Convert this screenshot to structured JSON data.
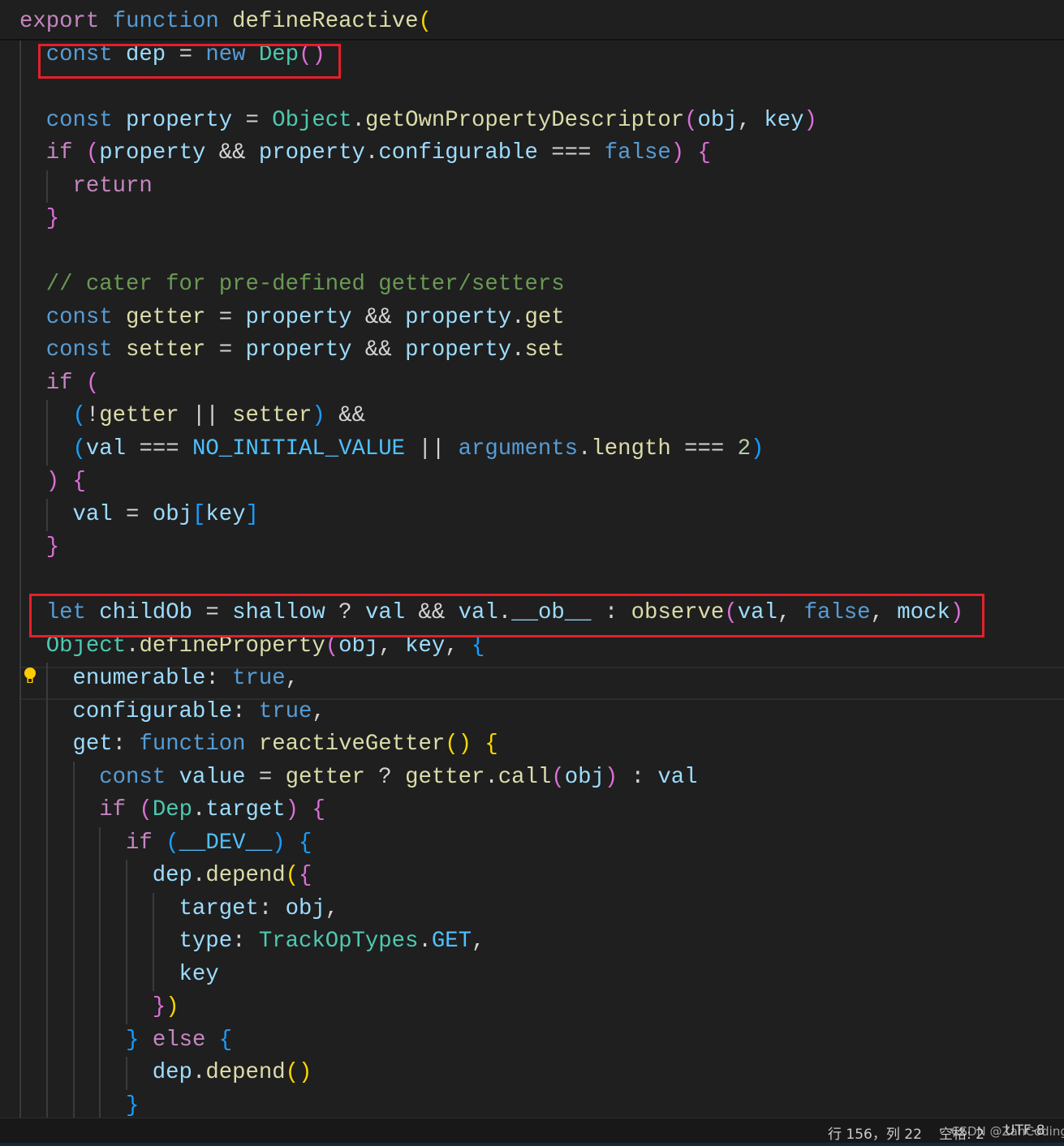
{
  "editor": {
    "indent_chars": 2,
    "current_line_index": 20,
    "highlighted_lines": [
      1,
      18
    ],
    "colors": {
      "background": "#1f1f1f",
      "keyword": "#569cd6",
      "control": "#c586c0",
      "variable": "#9cdcfe",
      "function": "#dcdcaa",
      "class": "#4ec9b0",
      "comment": "#6a9955",
      "bracket_level1": "#ffd700",
      "bracket_level2": "#da70d6",
      "bracket_level3": "#179fff",
      "highlight_box": "#e5202a"
    },
    "lines": [
      {
        "indent": 0,
        "tokens": [
          [
            "export",
            "ctl"
          ],
          [
            " "
          ],
          [
            "function",
            "kw"
          ],
          [
            " "
          ],
          [
            "defineReactive",
            "fn"
          ],
          [
            "(",
            "b1"
          ]
        ]
      },
      {
        "indent": 1,
        "tokens": [
          [
            "const",
            "kw"
          ],
          [
            " "
          ],
          [
            "dep",
            "var"
          ],
          [
            " = ",
            "op"
          ],
          [
            "new",
            "kw"
          ],
          [
            " "
          ],
          [
            "Dep",
            "cls"
          ],
          [
            "()",
            "b2"
          ]
        ]
      },
      {
        "indent": 1,
        "tokens": []
      },
      {
        "indent": 1,
        "tokens": [
          [
            "const",
            "kw"
          ],
          [
            " "
          ],
          [
            "property",
            "var"
          ],
          [
            " = ",
            "op"
          ],
          [
            "Object",
            "cls"
          ],
          [
            ".",
            "op"
          ],
          [
            "getOwnPropertyDescriptor",
            "fn"
          ],
          [
            "(",
            "b2"
          ],
          [
            "obj",
            "var"
          ],
          [
            ", ",
            "op"
          ],
          [
            "key",
            "var"
          ],
          [
            ")",
            "b2"
          ]
        ]
      },
      {
        "indent": 1,
        "tokens": [
          [
            "if",
            "ctl"
          ],
          [
            " "
          ],
          [
            "(",
            "b2"
          ],
          [
            "property",
            "var"
          ],
          [
            " && ",
            "op"
          ],
          [
            "property",
            "var"
          ],
          [
            ".",
            "op"
          ],
          [
            "configurable",
            "var"
          ],
          [
            " === ",
            "op"
          ],
          [
            "false",
            "kw"
          ],
          [
            ")",
            "b2"
          ],
          [
            " "
          ],
          [
            "{",
            "b2"
          ]
        ]
      },
      {
        "indent": 2,
        "tokens": [
          [
            "return",
            "ctl"
          ]
        ]
      },
      {
        "indent": 1,
        "tokens": [
          [
            "}",
            "b2"
          ]
        ]
      },
      {
        "indent": 1,
        "tokens": []
      },
      {
        "indent": 1,
        "tokens": [
          [
            "// cater for pre-defined getter/setters",
            "cmt"
          ]
        ]
      },
      {
        "indent": 1,
        "tokens": [
          [
            "const",
            "kw"
          ],
          [
            " "
          ],
          [
            "getter",
            "fn"
          ],
          [
            " = ",
            "op"
          ],
          [
            "property",
            "var"
          ],
          [
            " && ",
            "op"
          ],
          [
            "property",
            "var"
          ],
          [
            ".",
            "op"
          ],
          [
            "get",
            "fn"
          ]
        ]
      },
      {
        "indent": 1,
        "tokens": [
          [
            "const",
            "kw"
          ],
          [
            " "
          ],
          [
            "setter",
            "fn"
          ],
          [
            " = ",
            "op"
          ],
          [
            "property",
            "var"
          ],
          [
            " && ",
            "op"
          ],
          [
            "property",
            "var"
          ],
          [
            ".",
            "op"
          ],
          [
            "set",
            "fn"
          ]
        ]
      },
      {
        "indent": 1,
        "tokens": [
          [
            "if",
            "ctl"
          ],
          [
            " "
          ],
          [
            "(",
            "b2"
          ]
        ]
      },
      {
        "indent": 2,
        "tokens": [
          [
            "(",
            "b3"
          ],
          [
            "!",
            "op"
          ],
          [
            "getter",
            "fn"
          ],
          [
            " || ",
            "op"
          ],
          [
            "setter",
            "fn"
          ],
          [
            ")",
            "b3"
          ],
          [
            " &&",
            "op"
          ]
        ]
      },
      {
        "indent": 2,
        "tokens": [
          [
            "(",
            "b3"
          ],
          [
            "val",
            "var"
          ],
          [
            " === ",
            "op"
          ],
          [
            "NO_INITIAL_VALUE",
            "cst"
          ],
          [
            " || ",
            "op"
          ],
          [
            "arguments",
            "kw"
          ],
          [
            ".",
            "op"
          ],
          [
            "length",
            "fn"
          ],
          [
            " === ",
            "op"
          ],
          [
            "2",
            "num"
          ],
          [
            ")",
            "b3"
          ]
        ]
      },
      {
        "indent": 1,
        "tokens": [
          [
            ")",
            "b2"
          ],
          [
            " "
          ],
          [
            "{",
            "b2"
          ]
        ]
      },
      {
        "indent": 2,
        "tokens": [
          [
            "val",
            "var"
          ],
          [
            " = ",
            "op"
          ],
          [
            "obj",
            "var"
          ],
          [
            "[",
            "b3"
          ],
          [
            "key",
            "var"
          ],
          [
            "]",
            "b3"
          ]
        ]
      },
      {
        "indent": 1,
        "tokens": [
          [
            "}",
            "b2"
          ]
        ]
      },
      {
        "indent": 1,
        "tokens": []
      },
      {
        "indent": 1,
        "tokens": [
          [
            "let",
            "kw"
          ],
          [
            " "
          ],
          [
            "childOb",
            "var"
          ],
          [
            " = ",
            "op"
          ],
          [
            "shallow",
            "var"
          ],
          [
            " ? ",
            "op"
          ],
          [
            "val",
            "var"
          ],
          [
            " && ",
            "op"
          ],
          [
            "val",
            "var"
          ],
          [
            ".",
            "op"
          ],
          [
            "__ob__",
            "var"
          ],
          [
            " : ",
            "op"
          ],
          [
            "observe",
            "fn"
          ],
          [
            "(",
            "b2"
          ],
          [
            "val",
            "var"
          ],
          [
            ", ",
            "op"
          ],
          [
            "false",
            "kw"
          ],
          [
            ", ",
            "op"
          ],
          [
            "mock",
            "var"
          ],
          [
            ")",
            "b2"
          ]
        ]
      },
      {
        "indent": 1,
        "tokens": [
          [
            "Object",
            "cls"
          ],
          [
            ".",
            "op"
          ],
          [
            "defineProperty",
            "fn"
          ],
          [
            "(",
            "b2"
          ],
          [
            "obj",
            "var"
          ],
          [
            ", ",
            "op"
          ],
          [
            "key",
            "var"
          ],
          [
            ", ",
            "op"
          ],
          [
            "{",
            "b3"
          ]
        ]
      },
      {
        "indent": 2,
        "tokens": [
          [
            "enumerable",
            "var"
          ],
          [
            ": ",
            "op"
          ],
          [
            "true",
            "kw"
          ],
          [
            ",",
            "op"
          ]
        ]
      },
      {
        "indent": 2,
        "tokens": [
          [
            "configurable",
            "var"
          ],
          [
            ": ",
            "op"
          ],
          [
            "true",
            "kw"
          ],
          [
            ",",
            "op"
          ]
        ]
      },
      {
        "indent": 2,
        "tokens": [
          [
            "get",
            "var"
          ],
          [
            ": ",
            "op"
          ],
          [
            "function",
            "kw"
          ],
          [
            " "
          ],
          [
            "reactiveGetter",
            "fn"
          ],
          [
            "()",
            "b1"
          ],
          [
            " "
          ],
          [
            "{",
            "b1"
          ]
        ]
      },
      {
        "indent": 3,
        "tokens": [
          [
            "const",
            "kw"
          ],
          [
            " "
          ],
          [
            "value",
            "var"
          ],
          [
            " = ",
            "op"
          ],
          [
            "getter",
            "fn"
          ],
          [
            " ? ",
            "op"
          ],
          [
            "getter",
            "fn"
          ],
          [
            ".",
            "op"
          ],
          [
            "call",
            "fn"
          ],
          [
            "(",
            "b2"
          ],
          [
            "obj",
            "var"
          ],
          [
            ")",
            "b2"
          ],
          [
            " : ",
            "op"
          ],
          [
            "val",
            "var"
          ]
        ]
      },
      {
        "indent": 3,
        "tokens": [
          [
            "if",
            "ctl"
          ],
          [
            " "
          ],
          [
            "(",
            "b2"
          ],
          [
            "Dep",
            "cls"
          ],
          [
            ".",
            "op"
          ],
          [
            "target",
            "var"
          ],
          [
            ")",
            "b2"
          ],
          [
            " "
          ],
          [
            "{",
            "b2"
          ]
        ]
      },
      {
        "indent": 4,
        "tokens": [
          [
            "if",
            "ctl"
          ],
          [
            " "
          ],
          [
            "(",
            "b3"
          ],
          [
            "__DEV__",
            "cst"
          ],
          [
            ")",
            "b3"
          ],
          [
            " "
          ],
          [
            "{",
            "b3"
          ]
        ]
      },
      {
        "indent": 5,
        "tokens": [
          [
            "dep",
            "var"
          ],
          [
            ".",
            "op"
          ],
          [
            "depend",
            "fn"
          ],
          [
            "(",
            "b1"
          ],
          [
            "{",
            "b2"
          ]
        ]
      },
      {
        "indent": 6,
        "tokens": [
          [
            "target",
            "var"
          ],
          [
            ": ",
            "op"
          ],
          [
            "obj",
            "var"
          ],
          [
            ",",
            "op"
          ]
        ]
      },
      {
        "indent": 6,
        "tokens": [
          [
            "type",
            "var"
          ],
          [
            ": ",
            "op"
          ],
          [
            "TrackOpTypes",
            "cls"
          ],
          [
            ".",
            "op"
          ],
          [
            "GET",
            "cst"
          ],
          [
            ",",
            "op"
          ]
        ]
      },
      {
        "indent": 6,
        "tokens": [
          [
            "key",
            "var"
          ]
        ]
      },
      {
        "indent": 5,
        "tokens": [
          [
            "}",
            "b2"
          ],
          [
            ")",
            "b1"
          ]
        ]
      },
      {
        "indent": 4,
        "tokens": [
          [
            "}",
            "b3"
          ],
          [
            " "
          ],
          [
            "else",
            "ctl"
          ],
          [
            " "
          ],
          [
            "{",
            "b3"
          ]
        ]
      },
      {
        "indent": 5,
        "tokens": [
          [
            "dep",
            "var"
          ],
          [
            ".",
            "op"
          ],
          [
            "depend",
            "fn"
          ],
          [
            "()",
            "b1"
          ]
        ]
      },
      {
        "indent": 4,
        "tokens": [
          [
            "}",
            "b3"
          ]
        ]
      }
    ]
  },
  "statusbar": {
    "cursor_position": "行 156，列 22",
    "indentation": "空格: 2",
    "encoding": "UTF-8",
    "watermark": "CSDN @ZahCoding"
  },
  "icons": {
    "lightbulb": "lightbulb-icon"
  }
}
